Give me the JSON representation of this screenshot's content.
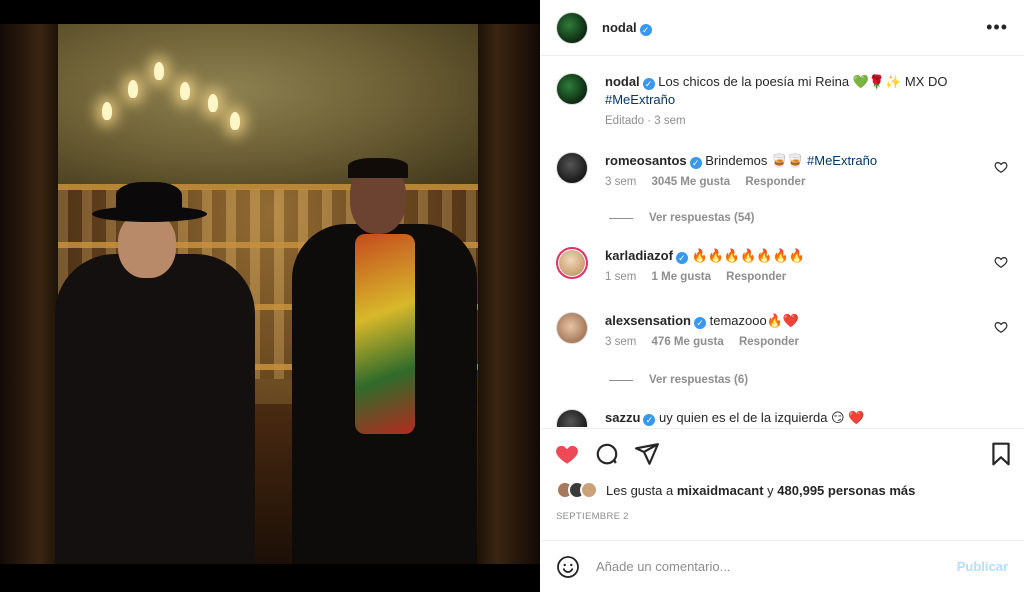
{
  "header": {
    "username": "nodal",
    "more_icon": "more-horizontal-icon"
  },
  "caption": {
    "username": "nodal",
    "text": "Los chicos de la poesía mi Reina 💚🌹✨ MX DO",
    "hashtag": "#MeExtraño",
    "meta": "Editado · 3 sem"
  },
  "comments": [
    {
      "username": "romeosantos",
      "text": "Brindemos 🥃🥃",
      "hashtag": "#MeExtraño",
      "time": "3 sem",
      "likes": "3045 Me gusta",
      "reply": "Responder",
      "view_replies": "Ver respuestas (54)"
    },
    {
      "username": "karladiazof",
      "text": "🔥🔥🔥🔥🔥🔥🔥",
      "time": "1 sem",
      "likes": "1 Me gusta",
      "reply": "Responder"
    },
    {
      "username": "alexsensation",
      "text": "temazooo🔥❤️",
      "time": "3 sem",
      "likes": "476 Me gusta",
      "reply": "Responder",
      "view_replies": "Ver respuestas (6)"
    },
    {
      "username": "sazzu",
      "text": "uy quien es el de la izquierda 😏 ❤️"
    }
  ],
  "likes": {
    "prefix": "Les gusta a",
    "user": "mixaidmacant",
    "connector": "y",
    "count": "480,995 personas más"
  },
  "date": "SEPTIEMBRE 2",
  "add_comment": {
    "placeholder": "Añade un comentario...",
    "publish": "Publicar"
  },
  "colors": {
    "like_red": "#ed4956",
    "link_blue": "#00376b",
    "verified_blue": "#3897f0",
    "publish_disabled": "#b2dffc"
  }
}
